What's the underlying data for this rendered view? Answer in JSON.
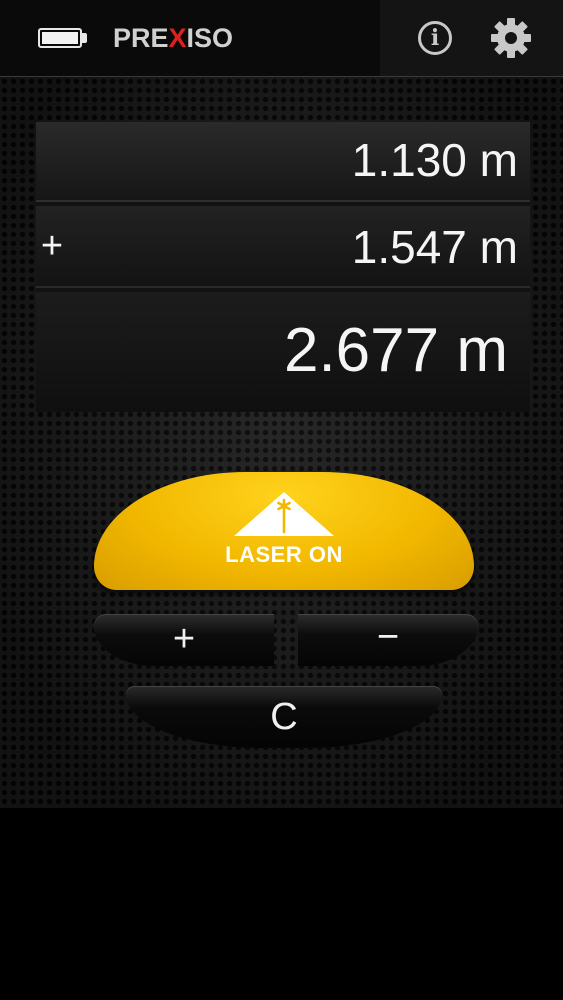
{
  "header": {
    "brand_prefix": "PRE",
    "brand_accent": "X",
    "brand_suffix": "ISO",
    "accent_color": "#e02020",
    "info_label": "i",
    "battery_icon": "battery-full-icon",
    "info_icon": "info-circle-icon",
    "settings_icon": "gear-icon"
  },
  "display": {
    "measurement_1": "1.130 m",
    "operator": "+",
    "measurement_2": "1.547 m",
    "result": "2.677 m"
  },
  "controls": {
    "laser_label": "LASER ON",
    "laser_color": "#f2b800",
    "plus_label": "+",
    "minus_label": "−",
    "clear_label": "C"
  }
}
